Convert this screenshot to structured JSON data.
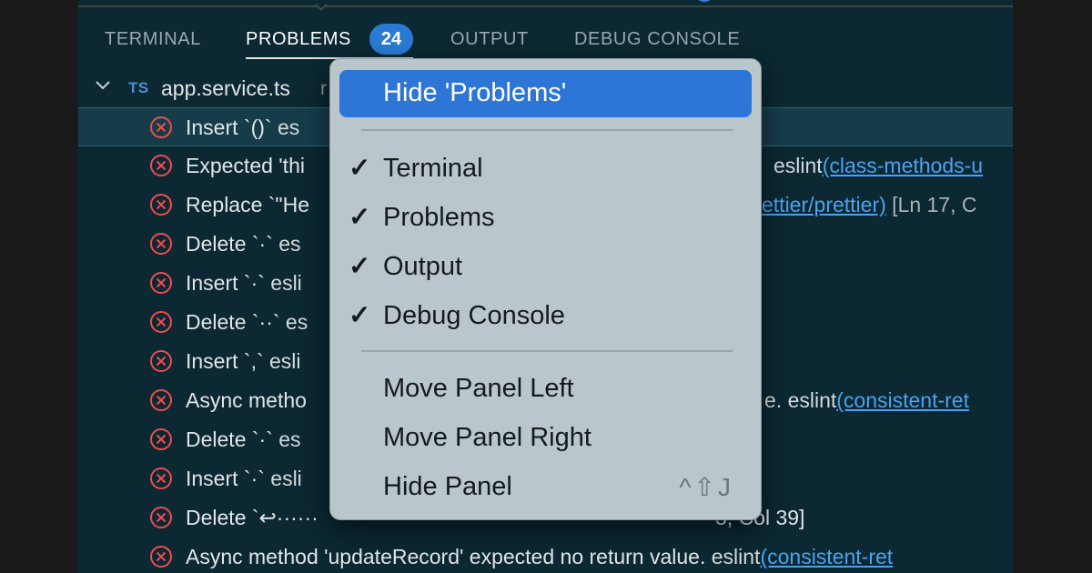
{
  "tabs": [
    {
      "label": "TERMINAL",
      "active": false
    },
    {
      "label": "PROBLEMS",
      "active": true
    },
    {
      "label": "OUTPUT",
      "active": false
    },
    {
      "label": "DEBUG CONSOLE",
      "active": false
    }
  ],
  "problems_count": "24",
  "file": {
    "lang_badge": "TS",
    "name": "app.service.ts",
    "path_fragment": "r"
  },
  "problems": [
    {
      "text": "Insert `()`",
      "src": "es",
      "link": "",
      "loc": ""
    },
    {
      "text": "Expected 'thi",
      "src": "eslint",
      "link": "(class-methods-u",
      "loc": ""
    },
    {
      "text": "Replace `\"He",
      "src": "",
      "link": "ettier/prettier)",
      "loc": "[Ln 17, C"
    },
    {
      "text": "Delete `·`",
      "src": "es",
      "link": "",
      "loc": ""
    },
    {
      "text": "Insert `·`",
      "src": "esli",
      "link": "",
      "loc": ""
    },
    {
      "text": "Delete `··`",
      "src": "es",
      "link": "",
      "loc": ""
    },
    {
      "text": "Insert `,`",
      "src": "esli",
      "link": "",
      "loc": ""
    },
    {
      "text": "Async metho",
      "src": "e. eslint",
      "link": "(consistent-ret",
      "loc": ""
    },
    {
      "text": "Delete `·`",
      "src": "es",
      "link": "",
      "loc": ""
    },
    {
      "text": "Insert `·`",
      "src": "esli",
      "link": "",
      "loc": ""
    },
    {
      "text": "Delete `↩······",
      "src": "",
      "link": "",
      "loc": "3, Col 39]"
    },
    {
      "text": "Async method 'updateRecord' expected no return value.",
      "src": "eslint",
      "link": "(consistent-ret",
      "loc": ""
    }
  ],
  "menu": {
    "hide_problems": "Hide 'Problems'",
    "terminal": "Terminal",
    "problems": "Problems",
    "output": "Output",
    "debug_console": "Debug Console",
    "move_left": "Move Panel Left",
    "move_right": "Move Panel Right",
    "hide_panel": "Hide Panel",
    "hide_panel_shortcut": "^⇧J",
    "check": "✓"
  }
}
